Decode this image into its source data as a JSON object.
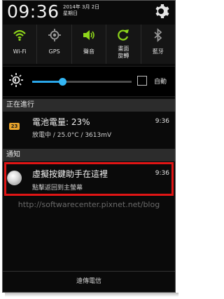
{
  "status": {
    "time": "09:36",
    "date_line1": "2014年 3月 2日",
    "date_line2": "星期日"
  },
  "toggles": [
    {
      "icon": "wifi-icon",
      "label": "Wi-Fi",
      "active": true
    },
    {
      "icon": "gps-icon",
      "label": "GPS",
      "active": false
    },
    {
      "icon": "sound-icon",
      "label": "聲音",
      "active": true
    },
    {
      "icon": "screen-rotation-icon",
      "label": "畫面\n旋轉",
      "active": true
    },
    {
      "icon": "bluetooth-icon",
      "label": "藍牙",
      "active": false
    }
  ],
  "brightness": {
    "level": 0.3,
    "auto_label": "自動",
    "auto_checked": false
  },
  "ongoing": {
    "header": "正在進行",
    "battery_badge": "23",
    "title": "電池電量: 23%",
    "subtitle": "放電中 / 25.0°C / 3613mV",
    "time": "9:36"
  },
  "notifications": {
    "header": "通知",
    "title": "虛擬按鍵助手在這裡",
    "subtitle": "點擊返回到主螢幕",
    "time": "9:36"
  },
  "watermark": "http://softwarecenter.pixnet.net/blog",
  "carrier": "遠傳電信",
  "colors": {
    "accent_green": "#8ed61b",
    "highlight_red": "#e01515",
    "slider_blue": "#2aa6e8"
  }
}
